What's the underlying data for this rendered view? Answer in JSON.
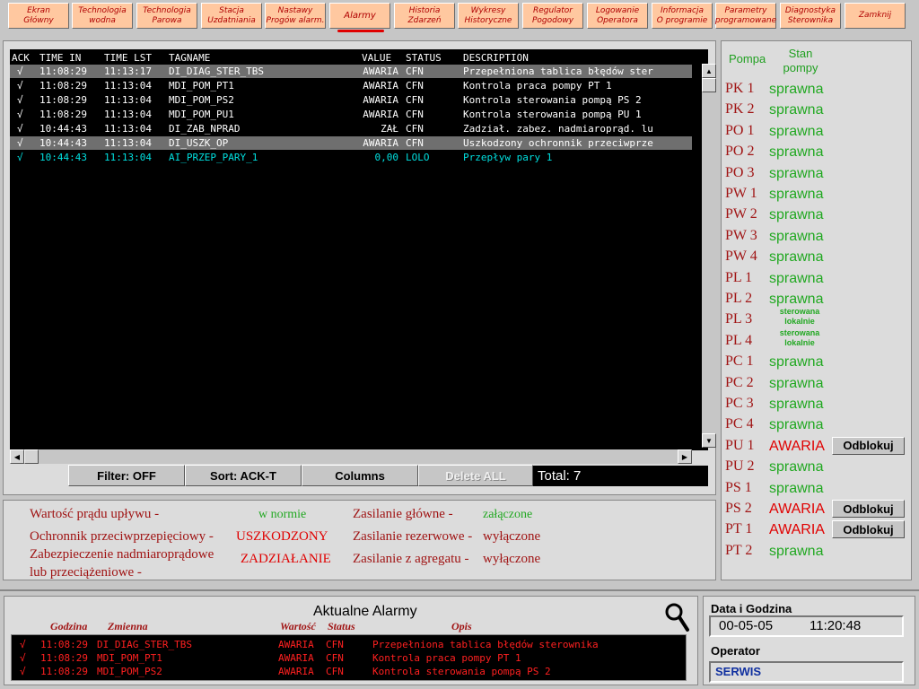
{
  "nav": [
    {
      "label": "Ekran\nGłówny"
    },
    {
      "label": "Technologia\nwodna"
    },
    {
      "label": "Technologia\nParowa"
    },
    {
      "label": "Stacja\nUzdatniania"
    },
    {
      "label": "Nastawy\nProgów alarm."
    },
    {
      "label": "Alarmy",
      "active": true
    },
    {
      "label": "Historia\nZdarzeń"
    },
    {
      "label": "Wykresy\nHistoryczne"
    },
    {
      "label": "Regulator\nPogodowy"
    },
    {
      "label": "Logowanie\nOperatora"
    },
    {
      "label": "Informacja\nO programie"
    },
    {
      "label": "Parametry\nprogramowane"
    },
    {
      "label": "Diagnostyka\nSterownika"
    },
    {
      "label": "Zamknij"
    }
  ],
  "alarm_list": {
    "headers": {
      "ack": "ACK",
      "time_in": "TIME IN",
      "time_lst": "TIME LST",
      "tagname": "TAGNAME",
      "value": "VALUE",
      "status": "STATUS",
      "description": "DESCRIPTION"
    },
    "rows": [
      {
        "ack": "√",
        "time_in": "11:08:29",
        "time_lst": "11:13:17",
        "tagname": "DI_DIAG_STER_TBS",
        "value": "AWARIA",
        "status": "CFN",
        "description": "Przepełniona tablica błędów ster",
        "selected": true,
        "color": "#ffffff"
      },
      {
        "ack": "√",
        "time_in": "11:08:29",
        "time_lst": "11:13:04",
        "tagname": "MDI_POM_PT1",
        "value": "AWARIA",
        "status": "CFN",
        "description": "Kontrola praca pompy PT 1",
        "selected": false,
        "color": "#ffffff"
      },
      {
        "ack": "√",
        "time_in": "11:08:29",
        "time_lst": "11:13:04",
        "tagname": "MDI_POM_PS2",
        "value": "AWARIA",
        "status": "CFN",
        "description": "Kontrola sterowania pompą PS 2",
        "selected": false,
        "color": "#ffffff"
      },
      {
        "ack": "√",
        "time_in": "11:08:29",
        "time_lst": "11:13:04",
        "tagname": "MDI_POM_PU1",
        "value": "AWARIA",
        "status": "CFN",
        "description": "Kontrola sterowania pompą PU 1",
        "selected": false,
        "color": "#ffffff"
      },
      {
        "ack": "√",
        "time_in": "10:44:43",
        "time_lst": "11:13:04",
        "tagname": "DI_ZAB_NPRAD",
        "value": "ZAŁ",
        "status": "CFN",
        "description": "Zadział. zabez. nadmiaroprąd. lu",
        "selected": false,
        "color": "#ffffff"
      },
      {
        "ack": "√",
        "time_in": "10:44:43",
        "time_lst": "11:13:04",
        "tagname": "DI_USZK_OP",
        "value": "AWARIA",
        "status": "CFN",
        "description": "Uszkodzony ochronnik przeciwprze",
        "selected": true,
        "color": "#ffffff"
      },
      {
        "ack": "√",
        "time_in": "10:44:43",
        "time_lst": "11:13:04",
        "tagname": "AI_PRZEP_PARY_1",
        "value": "0,00",
        "status": "LOLO",
        "description": "Przepływ pary 1",
        "selected": false,
        "color": "#00e0e0"
      }
    ]
  },
  "toolbar": {
    "filter": "Filter: OFF",
    "sort": "Sort: ACK-T",
    "columns": "Columns",
    "delete_all": "Delete ALL",
    "total": "Total: 7"
  },
  "status_panel": {
    "prad_label": "Wartość prądu upływu -",
    "prad_value": "w normie",
    "ochronnik_label": "Ochronnik przeciwprzepięciowy -",
    "ochronnik_value": "USZKODZONY",
    "zabezp_label_1": "Zabezpieczenie nadmiaroprądowe",
    "zabezp_label_2": "lub przeciążeniowe -",
    "zabezp_value": "ZADZIAŁANIE",
    "zas_glowne_label": "Zasilanie główne -",
    "zas_glowne_value": "załączone",
    "zas_rez_label": "Zasilanie rezerwowe -",
    "zas_rez_value": "wyłączone",
    "zas_agr_label": "Zasilanie z agregatu -",
    "zas_agr_value": "wyłączone"
  },
  "pumps": {
    "header_pompa": "Pompa",
    "header_stan": "Stan\npompy",
    "unlock_label": "Odblokuj",
    "items": [
      {
        "name": "PK 1",
        "state": "sprawna",
        "kind": "ok"
      },
      {
        "name": "PK 2",
        "state": "sprawna",
        "kind": "ok"
      },
      {
        "name": "PO 1",
        "state": "sprawna",
        "kind": "ok"
      },
      {
        "name": "PO 2",
        "state": "sprawna",
        "kind": "ok"
      },
      {
        "name": "PO 3",
        "state": "sprawna",
        "kind": "ok"
      },
      {
        "name": "PW 1",
        "state": "sprawna",
        "kind": "ok"
      },
      {
        "name": "PW 2",
        "state": "sprawna",
        "kind": "ok"
      },
      {
        "name": "PW 3",
        "state": "sprawna",
        "kind": "ok"
      },
      {
        "name": "PW 4",
        "state": "sprawna",
        "kind": "ok"
      },
      {
        "name": "PL 1",
        "state": "sprawna",
        "kind": "ok"
      },
      {
        "name": "PL 2",
        "state": "sprawna",
        "kind": "ok"
      },
      {
        "name": "PL 3",
        "state": "sterowana\nlokalnie",
        "kind": "local"
      },
      {
        "name": "PL 4",
        "state": "sterowana\nlokalnie",
        "kind": "local"
      },
      {
        "name": "PC 1",
        "state": "sprawna",
        "kind": "ok"
      },
      {
        "name": "PC 2",
        "state": "sprawna",
        "kind": "ok"
      },
      {
        "name": "PC 3",
        "state": "sprawna",
        "kind": "ok"
      },
      {
        "name": "PC 4",
        "state": "sprawna",
        "kind": "ok"
      },
      {
        "name": "PU 1",
        "state": "AWARIA",
        "kind": "bad"
      },
      {
        "name": "PU 2",
        "state": "sprawna",
        "kind": "ok"
      },
      {
        "name": "PS 1",
        "state": "sprawna",
        "kind": "ok"
      },
      {
        "name": "PS 2",
        "state": "AWARIA",
        "kind": "bad"
      },
      {
        "name": "PT 1",
        "state": "AWARIA",
        "kind": "bad"
      },
      {
        "name": "PT 2",
        "state": "sprawna",
        "kind": "ok"
      }
    ]
  },
  "current_alarms": {
    "title": "Aktualne Alarmy",
    "headers": {
      "godzina": "Godzina",
      "zmienna": "Zmienna",
      "wartosc": "Wartość",
      "status": "Status",
      "opis": "Opis"
    },
    "rows": [
      {
        "ack": "√",
        "time": "11:08:29",
        "tag": "DI_DIAG_STER_TBS",
        "value": "AWARIA",
        "status": "CFN",
        "desc": "Przepełniona tablica błędów sterownika"
      },
      {
        "ack": "√",
        "time": "11:08:29",
        "tag": "MDI_POM_PT1",
        "value": "AWARIA",
        "status": "CFN",
        "desc": "Kontrola praca pompy PT 1"
      },
      {
        "ack": "√",
        "time": "11:08:29",
        "tag": "MDI_POM_PS2",
        "value": "AWARIA",
        "status": "CFN",
        "desc": "Kontrola sterowania pompą PS 2"
      }
    ]
  },
  "datetime": {
    "label": "Data i Godzina",
    "date": "00-05-05",
    "time": "11:20:48"
  },
  "operator": {
    "label": "Operator",
    "name": "SERWIS"
  }
}
